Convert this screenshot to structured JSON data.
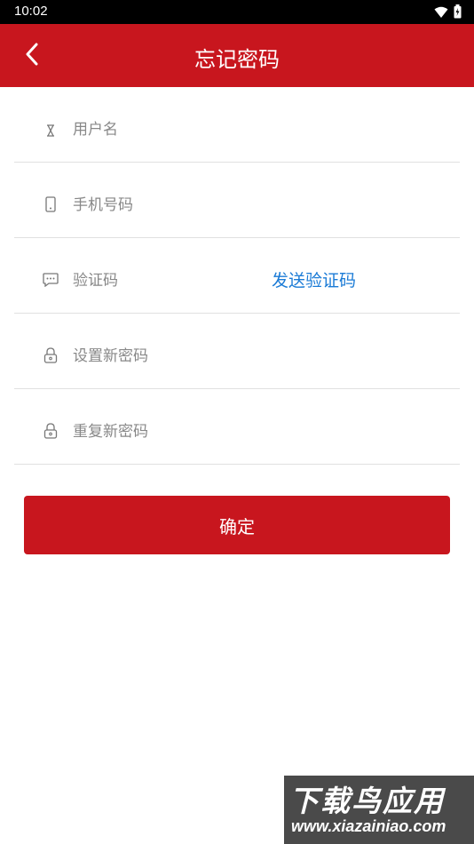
{
  "status_bar": {
    "time": "10:02"
  },
  "app_bar": {
    "title": "忘记密码"
  },
  "form": {
    "username_placeholder": "用户名",
    "phone_placeholder": "手机号码",
    "code_placeholder": "验证码",
    "send_code_label": "发送验证码",
    "new_password_placeholder": "设置新密码",
    "repeat_password_placeholder": "重复新密码"
  },
  "submit_label": "确定",
  "watermark": {
    "brand": "下载鸟应用",
    "url": "www.xiazainiao.com"
  },
  "colors": {
    "brand_red": "#c8161e",
    "link_blue": "#1b7bd6"
  },
  "icons": [
    "back-arrow-icon",
    "wifi-icon",
    "battery-icon",
    "user-icon",
    "phone-icon",
    "message-icon",
    "lock-icon"
  ]
}
